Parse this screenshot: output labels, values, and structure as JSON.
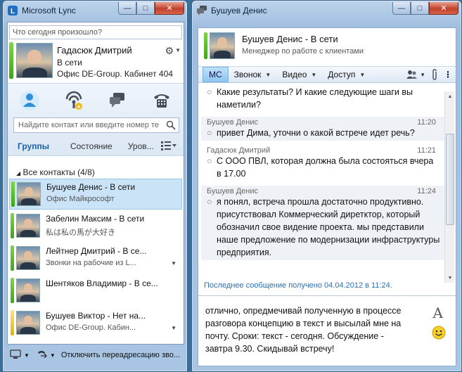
{
  "main_window": {
    "title": "Microsoft Lync",
    "status_placeholder": "Что сегодня произошло?",
    "me": {
      "name": "Гадасюк Дмитрий",
      "status": "В сети",
      "location": "Офис DE-Group. Кабинет 404"
    },
    "search_placeholder": "Найдите контакт или введите номер те",
    "view_tabs": [
      "Группы",
      "Состояние",
      "Уров..."
    ],
    "group_header": "Все контакты (4/8)",
    "contacts": [
      {
        "name": "Бушуев Денис - В сети",
        "note": "Офис Майкрософт",
        "presence": "green",
        "selected": true,
        "arrow": false
      },
      {
        "name": "Забелин Максим - В сети",
        "note": "私は私の馬が大好き",
        "presence": "green",
        "selected": false,
        "arrow": false
      },
      {
        "name": "Лейтнер Дмитрий - В се...",
        "note": "Звонки на рабочие из L...",
        "presence": "green",
        "selected": false,
        "arrow": true
      },
      {
        "name": "Шентяков Владимир - В се...",
        "note": "",
        "presence": "green",
        "selected": false,
        "arrow": false
      },
      {
        "name": "Бушуев Виктор - Нет на...",
        "note": "Офис DE-Group. Кабин...",
        "presence": "yellow",
        "selected": false,
        "arrow": true
      }
    ],
    "bottom_bar": "Отключить переадресацию зво..."
  },
  "conversation_window": {
    "title": "Бушуев Денис",
    "header_name": "Бушуев Денис - В сети",
    "header_title": "Менеджер по работе с клиентами",
    "toolbar": {
      "im": "МС",
      "call": "Звонок",
      "video": "Видео",
      "access": "Доступ"
    },
    "messages": [
      {
        "author": "",
        "time": "",
        "shaded": false,
        "lines": [
          "Какие результаты? И какие следующие шаги вы наметили?"
        ]
      },
      {
        "author": "Бушуев Денис",
        "time": "11:20",
        "shaded": true,
        "lines": [
          "привет Дима, уточни о какой встрече идет речь?"
        ]
      },
      {
        "author": "Гадасюк Дмитрий",
        "time": "11:21",
        "shaded": false,
        "lines": [
          "С ООО ПВЛ, которая должна была состояться вчера в 17.00"
        ]
      },
      {
        "author": "Бушуев Денис",
        "time": "11:24",
        "shaded": true,
        "lines": [
          "я понял, встреча прошла достаточно продуктивно. присутствовал Коммерческий диретктор, который обозначил свое видение проекта. мы представили наше предложение по модернизации инфраструктуры предприятия."
        ]
      }
    ],
    "last_message_notice": "Последнее сообщение получено 04.04.2012 в 11:24.",
    "compose_text": "отлично, опредмечивай полученную в процессе разговора концепцию в текст и высылай мне на почту. Сроки: текст - сегодня. Обсуждение - завтра 9.30. Скидывай встречу!"
  }
}
